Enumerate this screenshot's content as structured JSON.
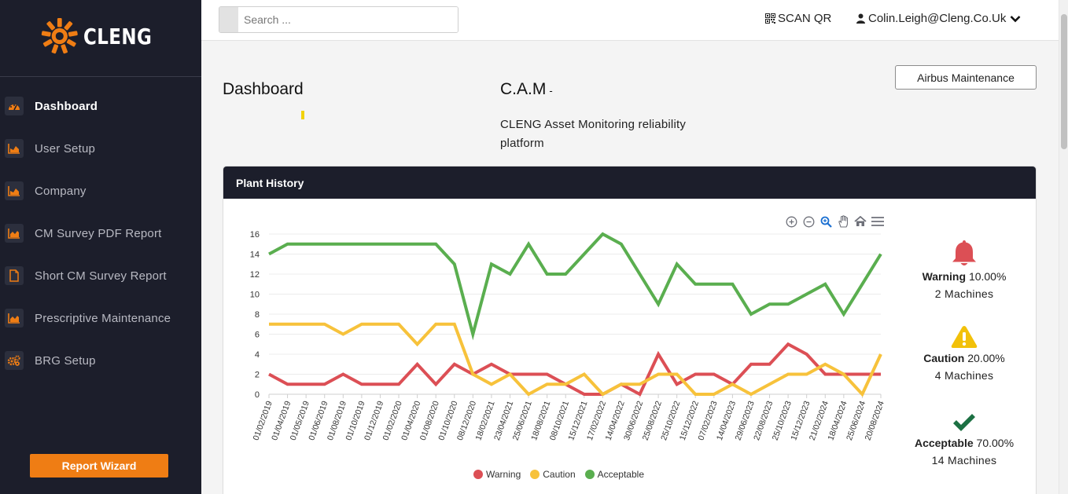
{
  "brand": {
    "name": "CLENG",
    "accent": "#ef7d14"
  },
  "sidebar": {
    "items": [
      {
        "label": "Dashboard",
        "icon": "dashboard-icon",
        "active": true
      },
      {
        "label": "User Setup",
        "icon": "area-chart-icon"
      },
      {
        "label": "Company",
        "icon": "area-chart-icon"
      },
      {
        "label": "CM Survey PDF Report",
        "icon": "area-chart-icon"
      },
      {
        "label": "Short CM Survey Report",
        "icon": "file-icon"
      },
      {
        "label": "Prescriptive Maintenance",
        "icon": "area-chart-icon"
      },
      {
        "label": "BRG Setup",
        "icon": "gears-icon"
      }
    ],
    "report_button": "Report Wizard"
  },
  "topbar": {
    "search_placeholder": "Search ...",
    "scan_qr": "SCAN QR",
    "user": "Colin.Leigh@Cleng.Co.Uk"
  },
  "header": {
    "title": "Dashboard",
    "cam_title": "C.A.M",
    "cam_dash": "-",
    "cam_description": "CLENG Asset Monitoring reliability platform",
    "site_button": "Airbus Maintenance"
  },
  "card": {
    "title": "Plant History"
  },
  "chart_data": {
    "type": "line",
    "x": [
      "01/02/2019",
      "01/04/2019",
      "01/05/2019",
      "01/06/2019",
      "01/08/2019",
      "01/10/2019",
      "01/12/2019",
      "01/02/2020",
      "01/04/2020",
      "01/08/2020",
      "01/10/2020",
      "08/12/2020",
      "18/02/2021",
      "23/04/2021",
      "25/06/2021",
      "18/08/2021",
      "08/10/2021",
      "15/12/2021",
      "17/02/2022",
      "14/04/2022",
      "30/06/2022",
      "25/08/2022",
      "25/10/2022",
      "15/12/2022",
      "07/02/2023",
      "14/04/2023",
      "29/06/2023",
      "22/08/2023",
      "25/10/2023",
      "15/12/2023",
      "21/02/2024",
      "18/04/2024",
      "25/06/2024",
      "20/08/2024"
    ],
    "series": [
      {
        "name": "Warning",
        "color": "#dc4f55",
        "values": [
          2,
          1,
          1,
          1,
          2,
          1,
          1,
          1,
          3,
          1,
          3,
          2,
          3,
          2,
          2,
          2,
          1,
          0,
          0,
          1,
          0,
          4,
          1,
          2,
          2,
          1,
          3,
          3,
          5,
          4,
          2,
          2,
          2,
          2
        ]
      },
      {
        "name": "Caution",
        "color": "#f7c23b",
        "values": [
          7,
          7,
          7,
          7,
          6,
          7,
          7,
          7,
          5,
          7,
          7,
          2,
          1,
          2,
          0,
          1,
          1,
          2,
          0,
          1,
          1,
          2,
          2,
          0,
          0,
          1,
          0,
          1,
          2,
          2,
          3,
          2,
          0,
          4
        ]
      },
      {
        "name": "Acceptable",
        "color": "#5aae4f",
        "values": [
          14,
          15,
          15,
          15,
          15,
          15,
          15,
          15,
          15,
          15,
          13,
          6,
          13,
          12,
          15,
          12,
          12,
          14,
          16,
          15,
          12,
          9,
          13,
          11,
          11,
          11,
          8,
          9,
          9,
          10,
          11,
          8,
          11,
          14
        ]
      }
    ],
    "ylim": [
      0,
      16
    ],
    "yticks": [
      "0",
      "2",
      "4",
      "6",
      "8",
      "10",
      "12",
      "14",
      "16"
    ],
    "legend": "bottom-center",
    "grid": true
  },
  "stats": {
    "warning": {
      "label": "Warning",
      "percent": "10.00%",
      "machines": "2 Machines",
      "color": "#dc4f55"
    },
    "caution": {
      "label": "Caution",
      "percent": "20.00%",
      "machines": "4 Machines",
      "color": "#f2c10a"
    },
    "acceptable": {
      "label": "Acceptable",
      "percent": "70.00%",
      "machines": "14 Machines",
      "color": "#1c7043"
    }
  }
}
